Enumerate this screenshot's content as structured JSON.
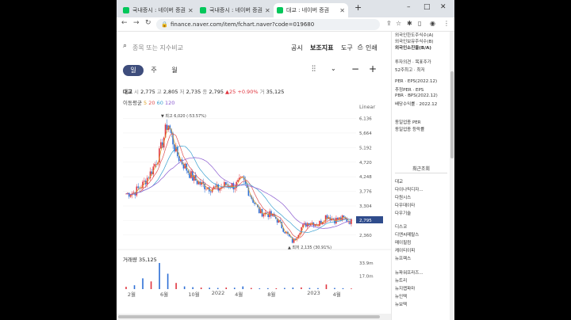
{
  "browser": {
    "tabs": [
      {
        "title": "국내증시 : 네이버 증권",
        "active": false
      },
      {
        "title": "국내증시 : 네이버 증권",
        "active": false
      },
      {
        "title": "대교 : 네이버 증권",
        "active": true
      }
    ],
    "new_tab": "+",
    "url": "finance.naver.com/item/fchart.naver?code=019680",
    "window_controls": [
      "–",
      "□",
      "✕"
    ]
  },
  "header": {
    "search_placeholder": "종목 또는 지수비교",
    "links": [
      "공시",
      "보조지표",
      "도구",
      "인쇄"
    ]
  },
  "periods": [
    "일",
    "주",
    "월"
  ],
  "active_period": "일",
  "stock": {
    "name": "대교",
    "open_label": "시",
    "open": "2,775",
    "high_label": "고",
    "high": "2,805",
    "low_label": "저",
    "low": "2,735",
    "close_label": "종",
    "close": "2,795",
    "change": "▲25",
    "change_pct": "+0.90%",
    "volume_label": "거",
    "volume": "35,125"
  },
  "ma": {
    "label": "이동평균",
    "periods": [
      "5",
      "20",
      "60",
      "120"
    ],
    "colors": [
      "#e0a020",
      "#e05050",
      "#3aa0d0",
      "#8a5ad0"
    ]
  },
  "scale_label": "Linear",
  "price_axis": [
    "6,136",
    "5,664",
    "5,192",
    "4,720",
    "4,248",
    "3,776",
    "3,304",
    "2,832",
    "2,360"
  ],
  "current_price_tag": "2,795",
  "max_note": "▼ 최고 6,020 (-53.57%)",
  "min_note": "▲ 최저 2,135 (30.91%)",
  "volume_axis": [
    "33.9m",
    "17.0m"
  ],
  "volume_title": "거래량 35,125",
  "x_labels": [
    "2월",
    "6월",
    "10월",
    "2022",
    "4월",
    "8월",
    "2023",
    "4월"
  ],
  "side": {
    "top_lines": [
      "외국인한도주식수(A)",
      "외국인보유주식수(B)",
      "외국인소진율(B/A)"
    ],
    "mid_lines": [
      "투자의견 · 목표주가",
      "52주최고 · 최저"
    ],
    "per_lines": [
      "PER · EPS(2022.12)",
      "추정PER · EPS",
      "PBR · BPS(2022.12)",
      "배당수익률 · 2022.12"
    ],
    "sector_lines": [
      "동일업종 PER",
      "동일업종 등락률"
    ],
    "recent_title": "최근조회",
    "recent_group1": [
      "대교",
      "다이나믹디자...",
      "다원시스",
      "다우데이타",
      "다우기술"
    ],
    "recent_group2": [
      "디스코",
      "디앤씨메탈스",
      "메이필컴",
      "케이티이피",
      "뉴프렉스"
    ],
    "recent_group3": [
      "뉴파워프라즈...",
      "뉴트리",
      "뉴지랩파마",
      "뉴인텍",
      "뉴보텍"
    ]
  },
  "chart_data": {
    "type": "line",
    "title": "",
    "xlabel": "",
    "ylabel": "",
    "ylim": [
      2100,
      6200
    ],
    "x": [
      "2021-02",
      "2021-03",
      "2021-04",
      "2021-05",
      "2021-06",
      "2021-07",
      "2021-08",
      "2021-09",
      "2021-10",
      "2021-11",
      "2021-12",
      "2022-01",
      "2022-02",
      "2022-03",
      "2022-04",
      "2022-05",
      "2022-06",
      "2022-07",
      "2022-08",
      "2022-09",
      "2022-10",
      "2022-11",
      "2022-12",
      "2023-01",
      "2023-02",
      "2023-03",
      "2023-04",
      "2023-05"
    ],
    "series": [
      {
        "values": [
          3700,
          3750,
          4000,
          4400,
          5000,
          6020,
          5000,
          4600,
          4200,
          4000,
          3900,
          3850,
          4000,
          3950,
          4150,
          3600,
          3100,
          3050,
          2900,
          2500,
          2135,
          2600,
          2800,
          2700,
          3000,
          2850,
          2900,
          2795
        ]
      }
    ],
    "volume": {
      "ylim": [
        0,
        36000000
      ],
      "values": [
        3000000,
        5000000,
        14000000,
        10000000,
        33900000,
        20000000,
        8000000,
        3500000,
        2500000,
        2000000,
        1800000,
        1500000,
        2000000,
        1800000,
        3500000,
        1500000,
        1000000,
        1200000,
        1100000,
        1500000,
        2000000,
        2200000,
        1500000,
        1300000,
        6000000,
        1500000,
        1200000,
        800000
      ]
    },
    "ma_periods": [
      5,
      20,
      60,
      120
    ]
  }
}
